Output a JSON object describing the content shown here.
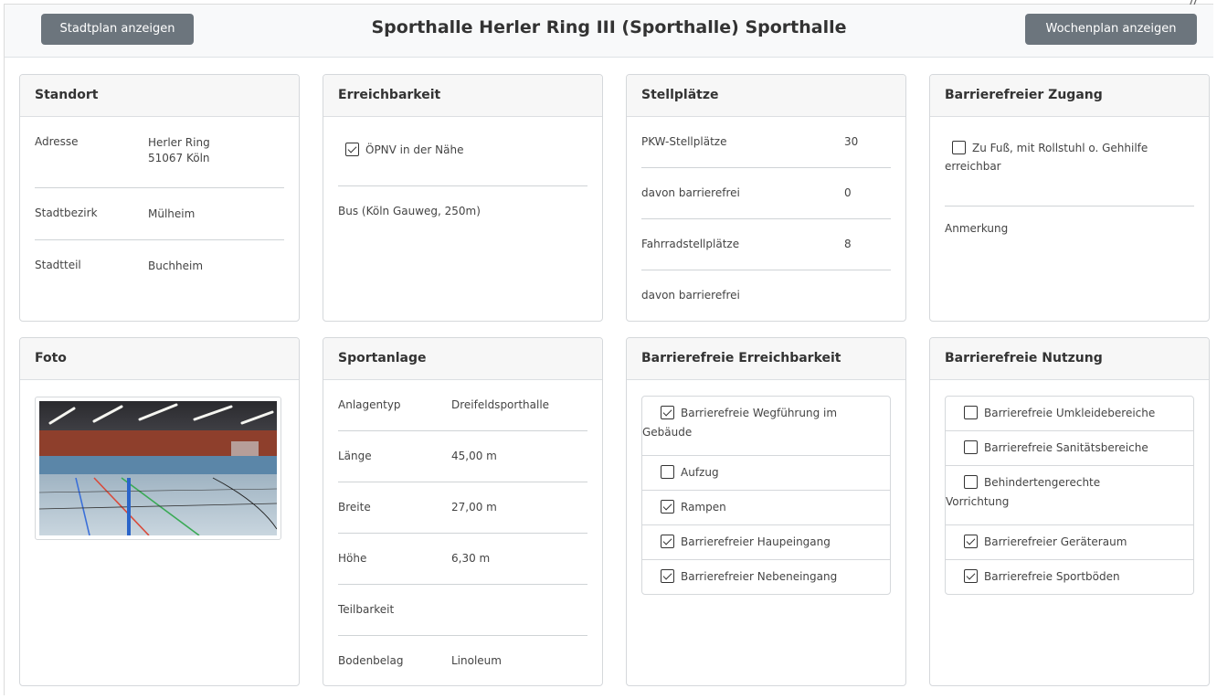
{
  "header": {
    "map_button": "Stadtplan anzeigen",
    "title": "Sporthalle Herler Ring III (Sporthalle) Sporthalle",
    "week_button": "Wochenplan anzeigen"
  },
  "standort": {
    "title": "Standort",
    "rows": [
      {
        "label": "Adresse",
        "value_line1": "Herler Ring",
        "value_line2": "51067 Köln"
      },
      {
        "label": "Stadtbezirk",
        "value_line1": "Mülheim"
      },
      {
        "label": "Stadtteil",
        "value_line1": "Buchheim"
      }
    ]
  },
  "erreichbarkeit": {
    "title": "Erreichbarkeit",
    "checkbox_label": "ÖPNV in der Nähe",
    "checkbox_checked": true,
    "detail": "Bus (Köln Gauweg, 250m)"
  },
  "stellplaetze": {
    "title": "Stellplätze",
    "rows": [
      {
        "label": "PKW-Stellplätze",
        "value": "30"
      },
      {
        "label": "davon barrierefrei",
        "value": "0"
      },
      {
        "label": "Fahrradstellplätze",
        "value": "8"
      },
      {
        "label": "davon barrierefrei",
        "value": ""
      }
    ]
  },
  "barrierefreier_zugang": {
    "title": "Barrierefreier Zugang",
    "checkbox_line1": "Zu Fuß, mit Rollstuhl o. Gehhilfe",
    "checkbox_line2": "erreichbar",
    "checkbox_checked": false,
    "remark_label": "Anmerkung"
  },
  "foto": {
    "title": "Foto"
  },
  "sportanlage": {
    "title": "Sportanlage",
    "rows": [
      {
        "label": "Anlagentyp",
        "value": "Dreifeldsporthalle"
      },
      {
        "label": "Länge",
        "value": "45,00 m"
      },
      {
        "label": "Breite",
        "value": "27,00 m"
      },
      {
        "label": "Höhe",
        "value": "6,30 m"
      },
      {
        "label": "Teilbarkeit",
        "value": ""
      },
      {
        "label": "Bodenbelag",
        "value": "Linoleum"
      }
    ]
  },
  "barrierefreie_erreichbarkeit": {
    "title": "Barrierefreie Erreichbarkeit",
    "items": [
      {
        "line1": "Barrierefreie Wegführung im",
        "line2": "Gebäude",
        "checked": true
      },
      {
        "line1": "Aufzug",
        "checked": false
      },
      {
        "line1": "Rampen",
        "checked": true
      },
      {
        "line1": "Barrierefreier Haupeingang",
        "checked": true
      },
      {
        "line1": "Barrierefreier Nebeneingang",
        "checked": true
      }
    ]
  },
  "barrierefreie_nutzung": {
    "title": "Barrierefreie Nutzung",
    "items": [
      {
        "line1": "Barrierefreie Umkleidebereiche",
        "checked": false
      },
      {
        "line1": "Barrierefreie Sanitätsbereiche",
        "checked": false
      },
      {
        "line1": "Behindertengerechte",
        "line2": "Vorrichtung",
        "checked": false
      },
      {
        "line1": "Barrierefreier Geräteraum",
        "checked": true
      },
      {
        "line1": "Barrierefreie Sportböden",
        "checked": true
      }
    ]
  },
  "colors": {
    "button_bg": "#6c757d",
    "header_bg": "#f8f9fa",
    "card_border": "#d5d8db"
  }
}
